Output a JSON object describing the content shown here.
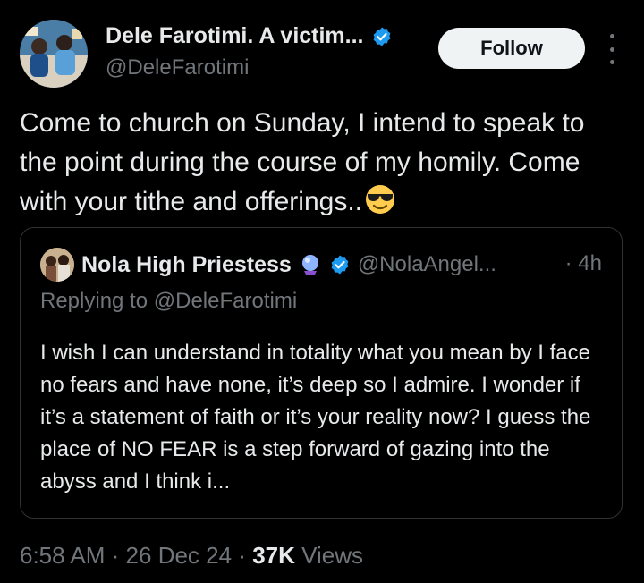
{
  "author": {
    "display_name": "Dele Farotimi. A victim...",
    "handle": "@DeleFarotimi",
    "verified": true,
    "avatar": "avatar-photo"
  },
  "actions": {
    "follow_label": "Follow",
    "more_icon": "more-vertical-icon"
  },
  "tweet": {
    "text": "Come to church on Sunday, I intend to speak to the point during the course of my homily. Come with your tithe and offerings..",
    "emoji": "smiling-face-with-sunglasses-icon"
  },
  "quoted_tweet": {
    "display_name": "Nola High Priestess",
    "name_emoji": "crystal-ball-icon",
    "verified": true,
    "handle": "@NolaAngel...",
    "time": "· 4h",
    "replying_prefix": "Replying to",
    "replying_to": "@DeleFarotimi",
    "text": "I wish I can understand in totality what you mean by I face no fears and have none, it’s deep so I admire. I wonder if it’s a statement of faith or it’s your reality now? I guess the place of NO FEAR is a step forward of gazing into the abyss and I think i..."
  },
  "meta": {
    "time": "6:58 AM",
    "sep1": "·",
    "date": "26 Dec 24",
    "sep2": "·",
    "views_count": "37K",
    "views_label": "Views"
  },
  "colors": {
    "background": "#000000",
    "text_primary": "#e7e9ea",
    "text_secondary": "#71767b",
    "verified_blue": "#1d9bf0",
    "border": "#2f3336"
  }
}
